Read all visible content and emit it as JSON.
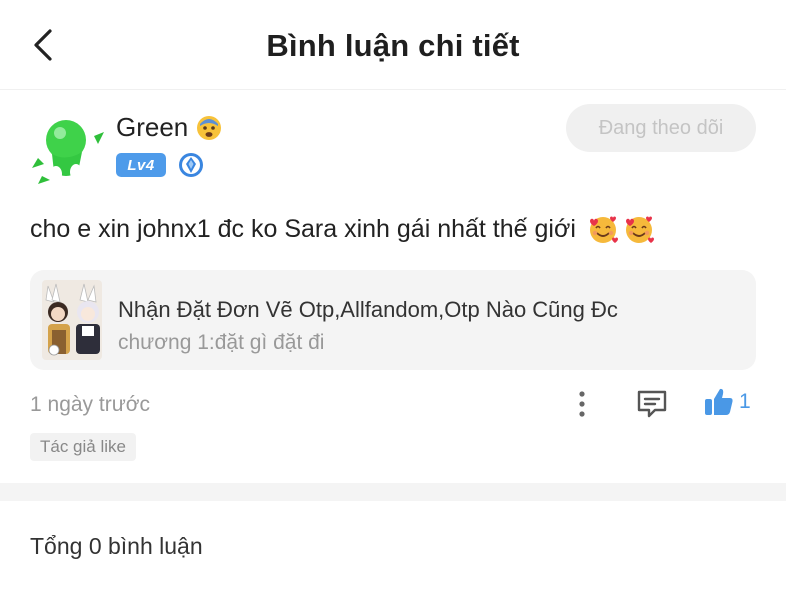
{
  "header": {
    "title": "Bình luận chi tiết",
    "back_icon": "chevron-left-icon"
  },
  "user": {
    "name": "Green",
    "status_emoji": "anxious-face-emoji",
    "level": "Lv4",
    "badge_icon": "blue-gem-badge-icon"
  },
  "follow_button": {
    "label": "Đang theo dõi"
  },
  "comment": {
    "text": "cho e xin johnx1 đc ko Sara xinh gái nhất thế giới",
    "emojis": [
      "smiling-face-with-hearts",
      "smiling-face-with-hearts"
    ]
  },
  "story": {
    "title": "Nhận Đặt Đơn Vẽ Otp,Allfandom,Otp Nào Cũng Đc",
    "chapter": "chương 1:đặt gì đặt đi"
  },
  "meta": {
    "time": "1 ngày trước",
    "like_count": "1",
    "author_like_tag": "Tác giả like"
  },
  "comments_section": {
    "total_label": "Tổng 0 bình luận"
  },
  "colors": {
    "accent_blue": "#4a98e6",
    "level_badge": "#4e9bea",
    "muted_text": "#999999",
    "card_bg": "#f4f4f4"
  }
}
